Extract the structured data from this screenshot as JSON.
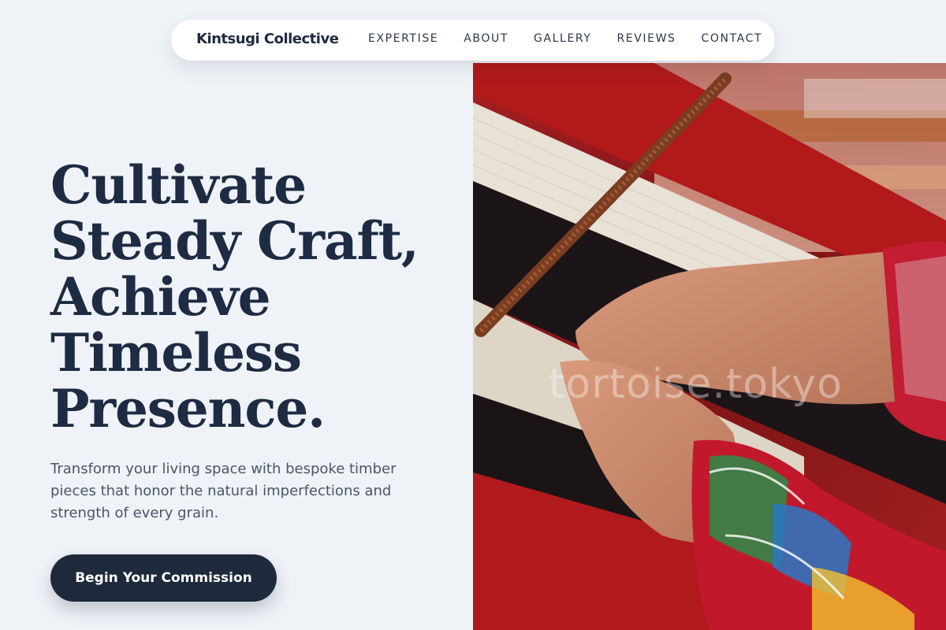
{
  "nav": {
    "brand": "Kintsugi Collective",
    "links": [
      "EXPERTISE",
      "ABOUT",
      "GALLERY",
      "REVIEWS",
      "CONTACT"
    ]
  },
  "hero": {
    "headline_lines": [
      "Cultivate",
      "Steady Craft,",
      "Achieve",
      "Timeless",
      "Presence."
    ],
    "subcopy": "Transform your living space with bespoke timber pieces that honor the natural imperfections and strength of every grain.",
    "cta_label": "Begin Your Commission",
    "image_watermark": "tortoise.tokyo"
  },
  "colors": {
    "background": "#eff3f7",
    "headline": "#1d2b43",
    "cta_background": "#1e293b",
    "body_text": "#4a5568"
  }
}
